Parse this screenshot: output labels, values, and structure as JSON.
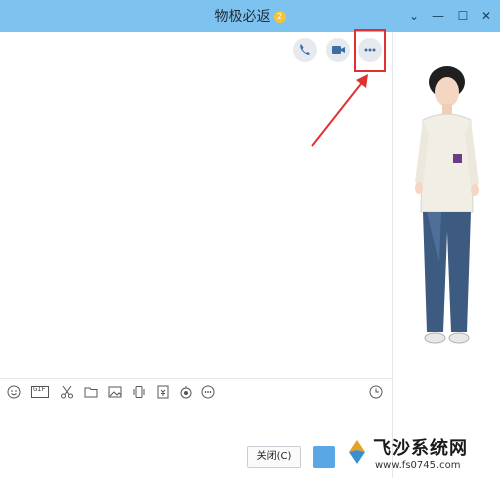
{
  "window": {
    "title": "物极必返",
    "badge": "2",
    "minimize_glyph": "—",
    "maximize_glyph": "☐",
    "close_glyph": "✕",
    "dropdown_glyph": "⌄"
  },
  "header_actions": [
    {
      "name": "phone-call",
      "icon": "phone-icon"
    },
    {
      "name": "video-call",
      "icon": "video-camera-icon"
    },
    {
      "name": "more-options",
      "icon": "more-dots-icon"
    }
  ],
  "toolbar": {
    "icons": [
      "emoji-icon",
      "gif-icon",
      "scissors-icon",
      "folder-icon",
      "image-icon",
      "shake-icon",
      "red-packet-icon",
      "voice-icon",
      "more-icon"
    ],
    "gif_label": "GIF",
    "history_icon": "clock-icon"
  },
  "buttons": {
    "close_label": "关闭(C)"
  },
  "watermark": {
    "text": "飞沙系统网",
    "url": "www.fs0745.com"
  },
  "colors": {
    "titlebar": "#7ec3f0",
    "highlight": "#e03030",
    "accent": "#5aa7e5"
  }
}
